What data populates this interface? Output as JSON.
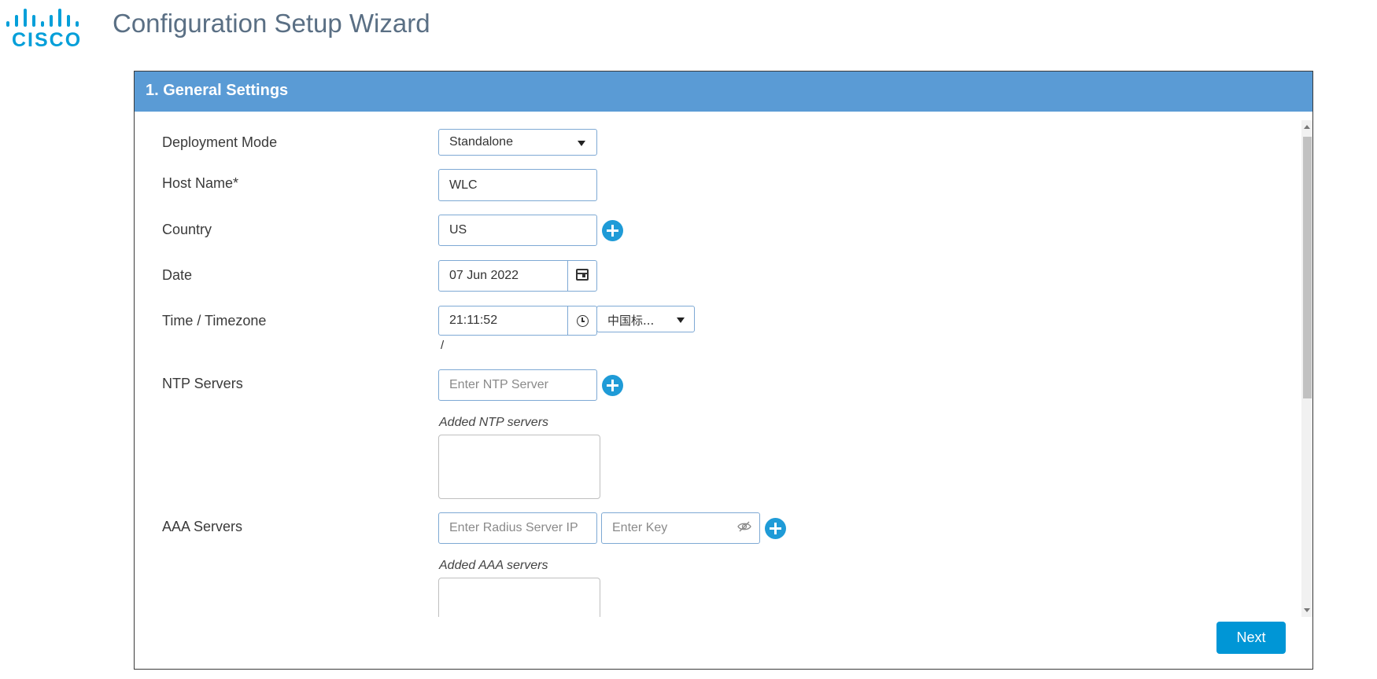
{
  "app": {
    "logo_text": "CISCO",
    "title": "Configuration Setup Wizard"
  },
  "section": {
    "title": "1. General Settings"
  },
  "form": {
    "deployment_mode": {
      "label": "Deployment Mode",
      "value": "Standalone"
    },
    "host_name": {
      "label": "Host Name*",
      "value": "WLC"
    },
    "country": {
      "label": "Country",
      "value": "US"
    },
    "date": {
      "label": "Date",
      "value": "07 Jun 2022"
    },
    "time": {
      "label": "Time / Timezone",
      "value": "21:11:52",
      "timezone": "中国标...",
      "separator": "/"
    },
    "ntp": {
      "label": "NTP Servers",
      "placeholder": "Enter NTP Server",
      "added_label": "Added NTP servers"
    },
    "aaa": {
      "label": "AAA Servers",
      "ip_placeholder": "Enter Radius Server IP",
      "key_placeholder": "Enter Key",
      "added_label": "Added AAA servers"
    }
  },
  "actions": {
    "next_label": "Next"
  },
  "colors": {
    "brand": "#049fd9",
    "header_bar": "#5a9bd5",
    "primary_button": "#0096d6",
    "add_icon": "#1f9bd7"
  },
  "icons": [
    "cisco-logo",
    "add-icon",
    "calendar-icon",
    "clock-icon",
    "eye-slash-icon",
    "chevron-down-icon"
  ]
}
